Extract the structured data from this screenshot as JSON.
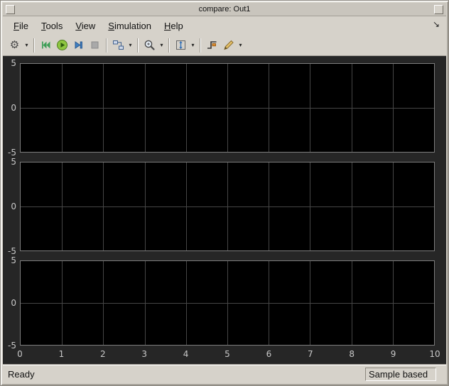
{
  "titlebar": {
    "title": "compare: Out1",
    "left_button": "window-menu-icon",
    "right_button": "close-icon"
  },
  "menu": {
    "items": [
      {
        "label": "File",
        "mnemonic": "F"
      },
      {
        "label": "Tools",
        "mnemonic": "T"
      },
      {
        "label": "View",
        "mnemonic": "V"
      },
      {
        "label": "Simulation",
        "mnemonic": "S"
      },
      {
        "label": "Help",
        "mnemonic": "H"
      }
    ],
    "dock_arrow": "↘"
  },
  "toolbar": {
    "gear_glyph": "⚙",
    "dropdown_glyph": "▾",
    "buttons": [
      {
        "name": "settings",
        "icon": "gear-icon",
        "dropdown": true
      },
      {
        "name": "step-back",
        "icon": "step-back-icon",
        "dropdown": false
      },
      {
        "name": "run",
        "icon": "run-icon",
        "dropdown": false
      },
      {
        "name": "step-forward",
        "icon": "step-forward-icon",
        "dropdown": false
      },
      {
        "name": "stop",
        "icon": "stop-icon",
        "dropdown": false
      },
      {
        "name": "highlight-block",
        "icon": "block-diagram-icon",
        "dropdown": true
      },
      {
        "name": "zoom",
        "icon": "magnifier-icon",
        "dropdown": true
      },
      {
        "name": "fit-to-view",
        "icon": "fit-to-view-icon",
        "dropdown": true
      },
      {
        "name": "trigger",
        "icon": "trigger-icon",
        "dropdown": false
      },
      {
        "name": "measurements",
        "icon": "pencil-icon",
        "dropdown": true
      }
    ]
  },
  "statusbar": {
    "left": "Ready",
    "right": "Sample based"
  },
  "chart_data": {
    "type": "line",
    "title": "",
    "subplot_layout": "3 stacked subplots, shared x axis",
    "x_ticks": [
      0,
      1,
      2,
      3,
      4,
      5,
      6,
      7,
      8,
      9,
      10
    ],
    "xlim": [
      0,
      10
    ],
    "xlabel": "",
    "ylabel": "",
    "grid": true,
    "legend": "none",
    "subplots": [
      {
        "ylim": [
          -5,
          5
        ],
        "y_ticks": [
          5,
          0,
          -5
        ],
        "series": []
      },
      {
        "ylim": [
          -5,
          5
        ],
        "y_ticks": [
          5,
          0,
          -5
        ],
        "series": []
      },
      {
        "ylim": [
          -5,
          5
        ],
        "y_ticks": [
          5,
          0,
          -5
        ],
        "series": []
      }
    ]
  },
  "colors": {
    "chrome": "#d6d2ca",
    "titlebar": "#c9c5bd",
    "canvas": "#262626",
    "plot_bg": "#000000",
    "grid": "#464646",
    "tick_label": "#c8c8c8",
    "run_green": "#8ec641",
    "step_blue": "#3f7fc1"
  }
}
